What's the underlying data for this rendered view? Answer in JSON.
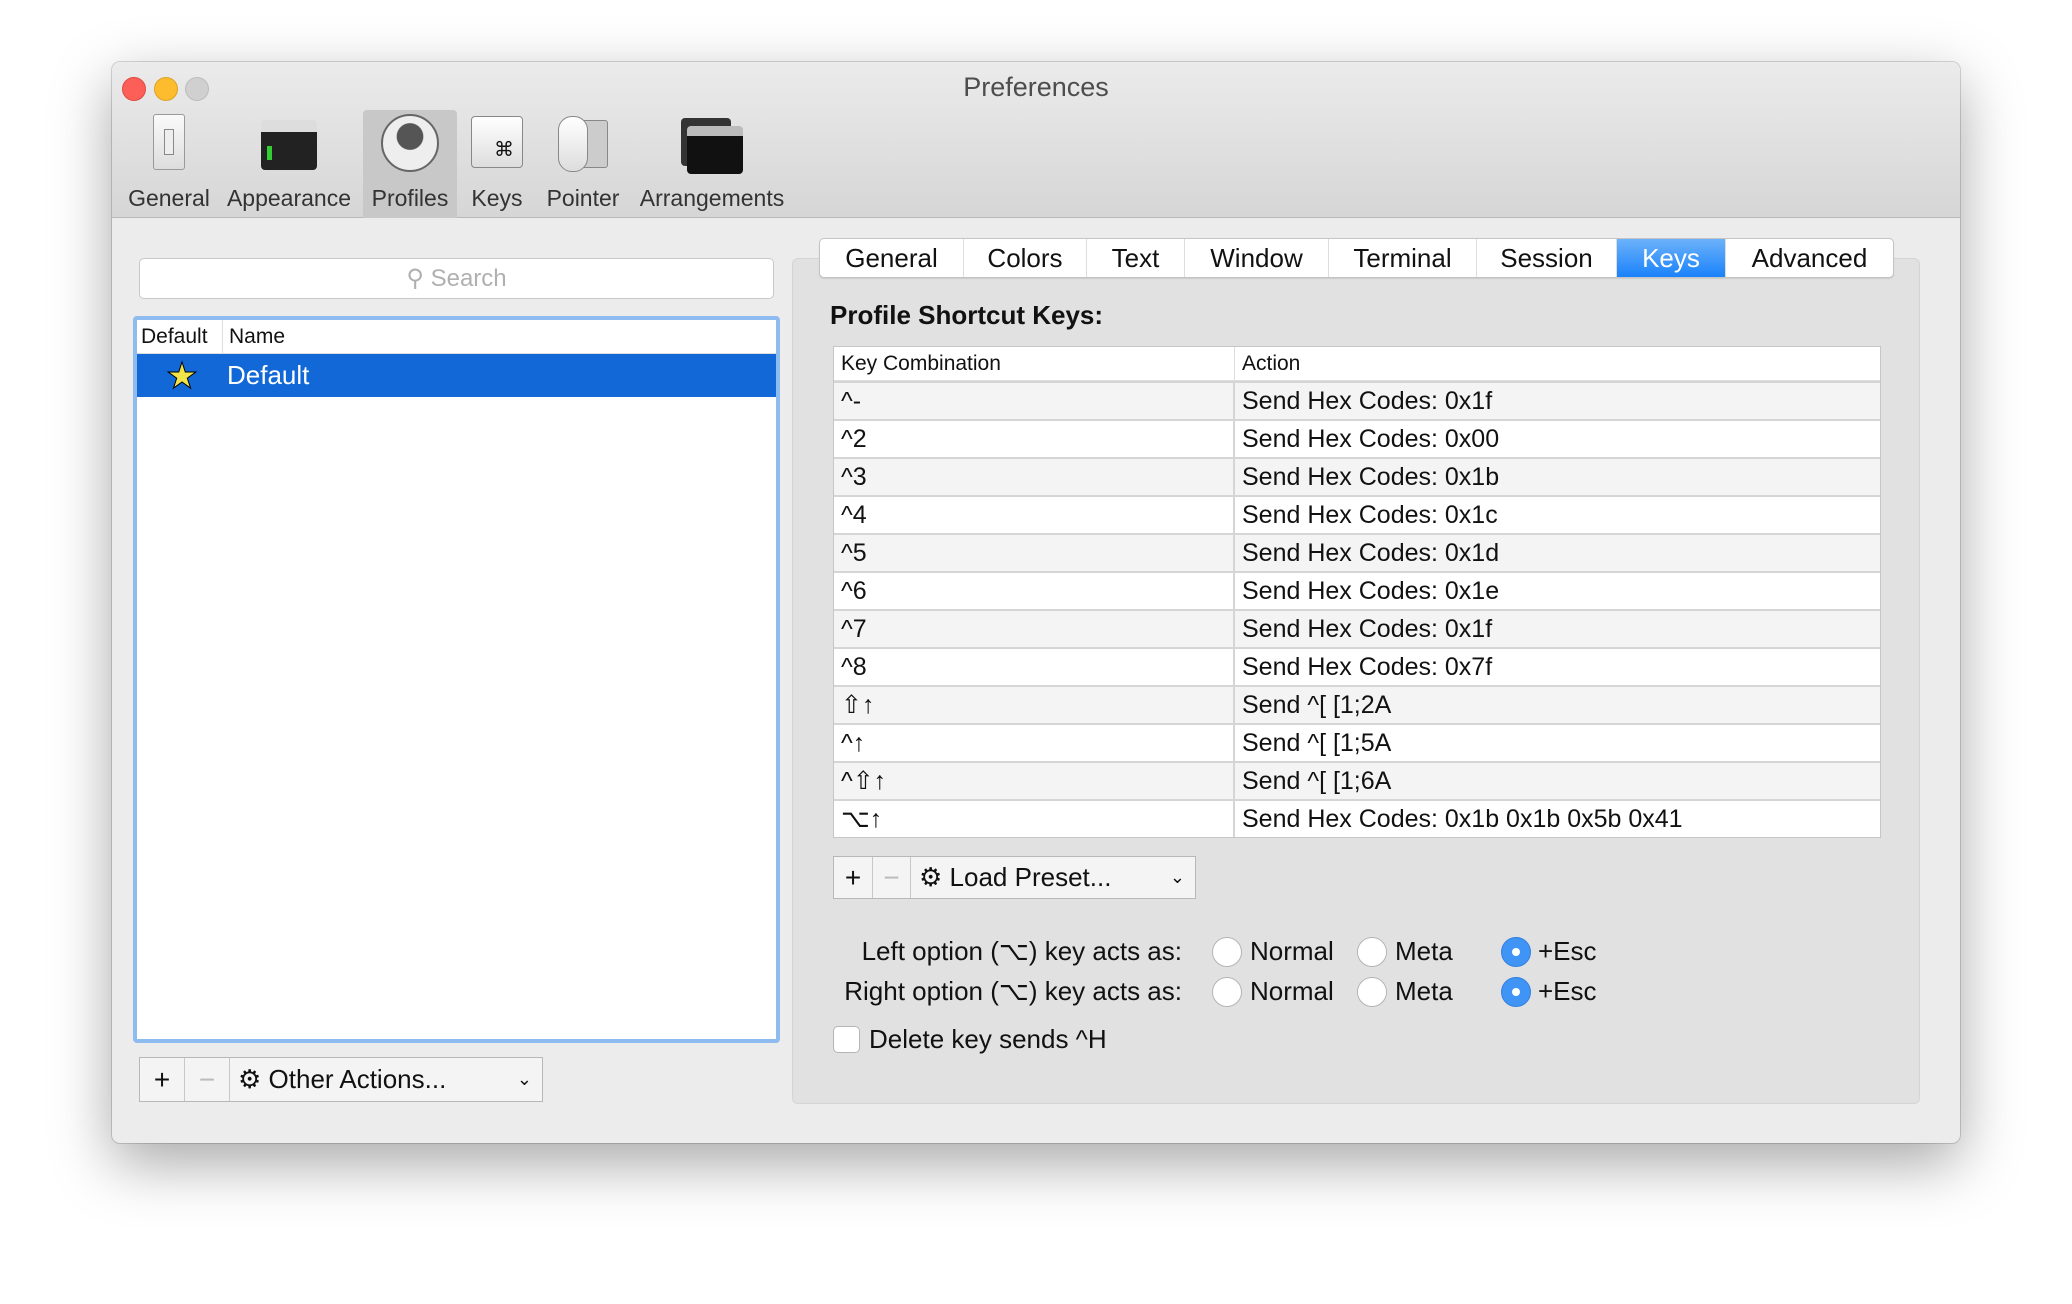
{
  "window": {
    "title": "Preferences"
  },
  "toolbar": {
    "items": [
      {
        "label": "General",
        "icon": "switch-icon"
      },
      {
        "label": "Appearance",
        "icon": "terminal-window-icon"
      },
      {
        "label": "Profiles",
        "icon": "user-silhouette-icon",
        "selected": true
      },
      {
        "label": "Keys",
        "icon": "command-key-icon"
      },
      {
        "label": "Pointer",
        "icon": "mouse-icon"
      },
      {
        "label": "Arrangements",
        "icon": "windows-stack-icon"
      }
    ]
  },
  "sidebar": {
    "search_placeholder": "Search",
    "columns": [
      "Default",
      "Name"
    ],
    "profiles": [
      {
        "name": "Default",
        "is_default": true,
        "selected": true
      }
    ],
    "add": "+",
    "remove": "−",
    "other_actions": "Other Actions..."
  },
  "tabs": [
    {
      "label": "General"
    },
    {
      "label": "Colors"
    },
    {
      "label": "Text"
    },
    {
      "label": "Window"
    },
    {
      "label": "Terminal"
    },
    {
      "label": "Session"
    },
    {
      "label": "Keys",
      "selected": true
    },
    {
      "label": "Advanced"
    }
  ],
  "keys": {
    "section_title": "Profile Shortcut Keys:",
    "columns": [
      "Key Combination",
      "Action"
    ],
    "rows": [
      {
        "key": "^-",
        "action": "Send Hex Codes: 0x1f"
      },
      {
        "key": "^2",
        "action": "Send Hex Codes: 0x00"
      },
      {
        "key": "^3",
        "action": "Send Hex Codes: 0x1b"
      },
      {
        "key": "^4",
        "action": "Send Hex Codes: 0x1c"
      },
      {
        "key": "^5",
        "action": "Send Hex Codes: 0x1d"
      },
      {
        "key": "^6",
        "action": "Send Hex Codes: 0x1e"
      },
      {
        "key": "^7",
        "action": "Send Hex Codes: 0x1f"
      },
      {
        "key": "^8",
        "action": "Send Hex Codes: 0x7f"
      },
      {
        "key": "⇧↑",
        "action": "Send ^[ [1;2A"
      },
      {
        "key": "^↑",
        "action": "Send ^[ [1;5A"
      },
      {
        "key": "^⇧↑",
        "action": "Send ^[ [1;6A"
      },
      {
        "key": "⌥↑",
        "action": "Send Hex Codes: 0x1b 0x1b 0x5b 0x41"
      }
    ],
    "add": "+",
    "remove": "−",
    "load_preset": "Load Preset...",
    "left_option_label": "Left option (⌥) key acts as:",
    "right_option_label": "Right option (⌥) key acts as:",
    "options": [
      "Normal",
      "Meta",
      "+Esc"
    ],
    "left_option_value": "+Esc",
    "right_option_value": "+Esc",
    "delete_sends_h_label": "Delete key sends ^H",
    "delete_sends_h": false
  },
  "colors": {
    "accent": "#1168d6",
    "tab_selected": "#1a82fb"
  }
}
